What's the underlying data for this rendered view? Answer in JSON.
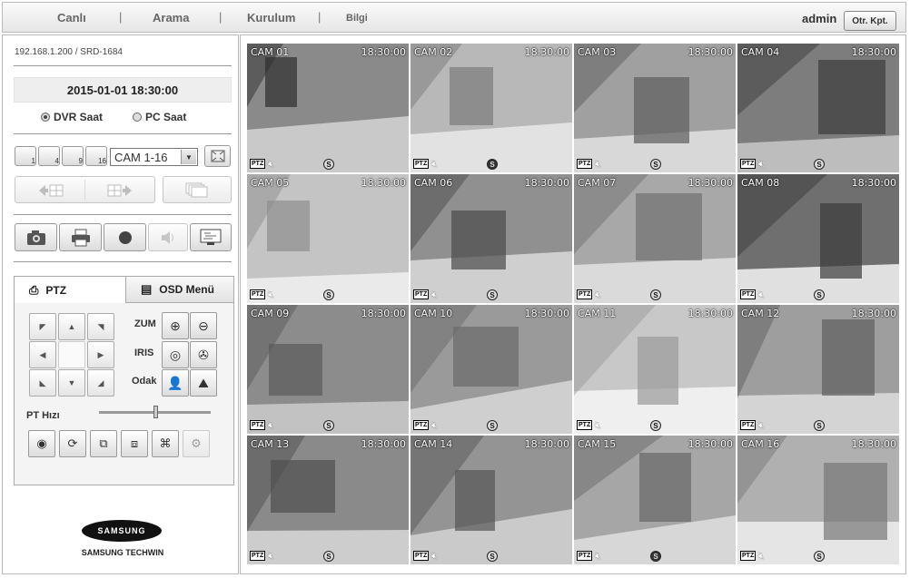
{
  "header": {
    "nav": [
      "Canlı",
      "Arama",
      "Kurulum",
      "Bilgi"
    ],
    "separator": "|",
    "user": "admin",
    "logout_label": "Otr. Kpt."
  },
  "sidebar": {
    "address": "192.168.1.200 / SRD-1684",
    "datetime": "2015-01-01  18:30:00",
    "time_source": {
      "dvr_label": "DVR Saat",
      "pc_label": "PC Saat",
      "selected": "DVR Saat"
    },
    "split_buttons": [
      "1",
      "4",
      "9",
      "16"
    ],
    "camera_select": "CAM 1-16",
    "ptz": {
      "tab_ptz": "PTZ",
      "tab_osd": "OSD Menü",
      "zoom_label": "ZUM",
      "iris_label": "IRIS",
      "focus_label": "Odak",
      "speed_label": "PT Hızı",
      "speed_level": 0.5
    },
    "logo_oval": "SAMSUNG",
    "logo_text": "SAMSUNG TECHWIN"
  },
  "cameras": [
    {
      "name": "CAM 01",
      "time": "18:30:00"
    },
    {
      "name": "CAM 02",
      "time": "18:30:00"
    },
    {
      "name": "CAM 03",
      "time": "18:30:00"
    },
    {
      "name": "CAM 04",
      "time": "18:30:00"
    },
    {
      "name": "CAM 05",
      "time": "18:30:00"
    },
    {
      "name": "CAM 06",
      "time": "18:30:00"
    },
    {
      "name": "CAM 07",
      "time": "18:30:00"
    },
    {
      "name": "CAM 08",
      "time": "18:30:00"
    },
    {
      "name": "CAM 09",
      "time": "18:30:00"
    },
    {
      "name": "CAM 10",
      "time": "18:30:00"
    },
    {
      "name": "CAM 11",
      "time": "18:30:00"
    },
    {
      "name": "CAM 12",
      "time": "18:30:00"
    },
    {
      "name": "CAM 13",
      "time": "18:30:00"
    },
    {
      "name": "CAM 14",
      "time": "18:30:00"
    },
    {
      "name": "CAM 15",
      "time": "18:30:00"
    },
    {
      "name": "CAM 16",
      "time": "18:30:00"
    }
  ],
  "overlay": {
    "ptz_badge": "PTZ",
    "status_mark": "S"
  }
}
